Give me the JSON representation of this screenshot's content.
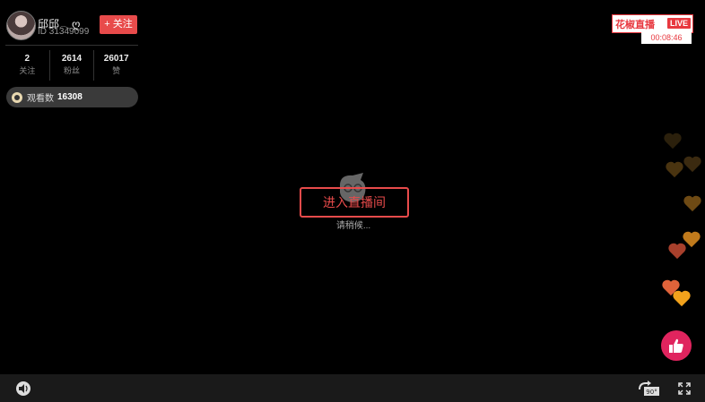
{
  "streamer": {
    "name": "邱邱𓂃ღ",
    "id_text": "ID 31349099",
    "follow_label": "+ 关注"
  },
  "stats": [
    {
      "value": "2",
      "label": "关注"
    },
    {
      "value": "2614",
      "label": "粉丝"
    },
    {
      "value": "26017",
      "label": "赞"
    }
  ],
  "viewers": {
    "label": "观看数",
    "count": "16308"
  },
  "brand": {
    "name": "花椒直播",
    "live_badge": "LIVE",
    "timer": "00:08:46"
  },
  "center": {
    "enter_label": "进入直播间",
    "waiting_text": "请稍候..."
  },
  "controls": {
    "rotate_badge": "90°"
  },
  "colors": {
    "accent": "#e84b4b",
    "like": "#e0245e"
  }
}
